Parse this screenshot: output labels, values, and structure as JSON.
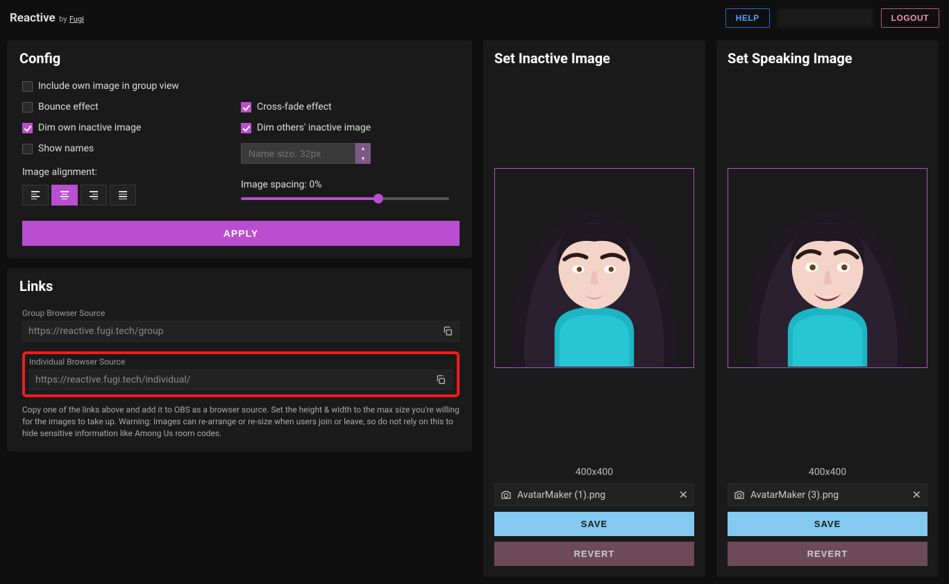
{
  "header": {
    "brand": "Reactive",
    "by": "by",
    "author": "Fugi",
    "help": "HELP",
    "logout": "LOGOUT"
  },
  "config": {
    "title": "Config",
    "include_own": {
      "label": "Include own image in group view",
      "checked": false
    },
    "bounce": {
      "label": "Bounce effect",
      "checked": false
    },
    "crossfade": {
      "label": "Cross-fade effect",
      "checked": true
    },
    "dim_own": {
      "label": "Dim own inactive image",
      "checked": true
    },
    "dim_others": {
      "label": "Dim others' inactive image",
      "checked": true
    },
    "show_names": {
      "label": "Show names",
      "checked": false
    },
    "name_size_placeholder": "Name size: 32px",
    "alignment_label": "Image alignment:",
    "spacing_label": "Image spacing: 0%",
    "spacing_percent": 0,
    "apply": "APPLY"
  },
  "links": {
    "title": "Links",
    "group_label": "Group Browser Source",
    "group_url": "https://reactive.fugi.tech/group",
    "individual_label": "Individual Browser Source",
    "individual_url": "https://reactive.fugi.tech/individual/",
    "help_text": "Copy one of the links above and add it to OBS as a browser source. Set the height & width to the max size you're willing for the images to take up. Warning: Images can re-arrange or re-size when users join or leave, so do not rely on this to hide sensitive information like Among Us room codes."
  },
  "inactive": {
    "title": "Set Inactive Image",
    "dimensions": "400x400",
    "filename": "AvatarMaker (1).png",
    "save": "SAVE",
    "revert": "REVERT"
  },
  "speaking": {
    "title": "Set Speaking Image",
    "dimensions": "400x400",
    "filename": "AvatarMaker (3).png",
    "save": "SAVE",
    "revert": "REVERT"
  }
}
